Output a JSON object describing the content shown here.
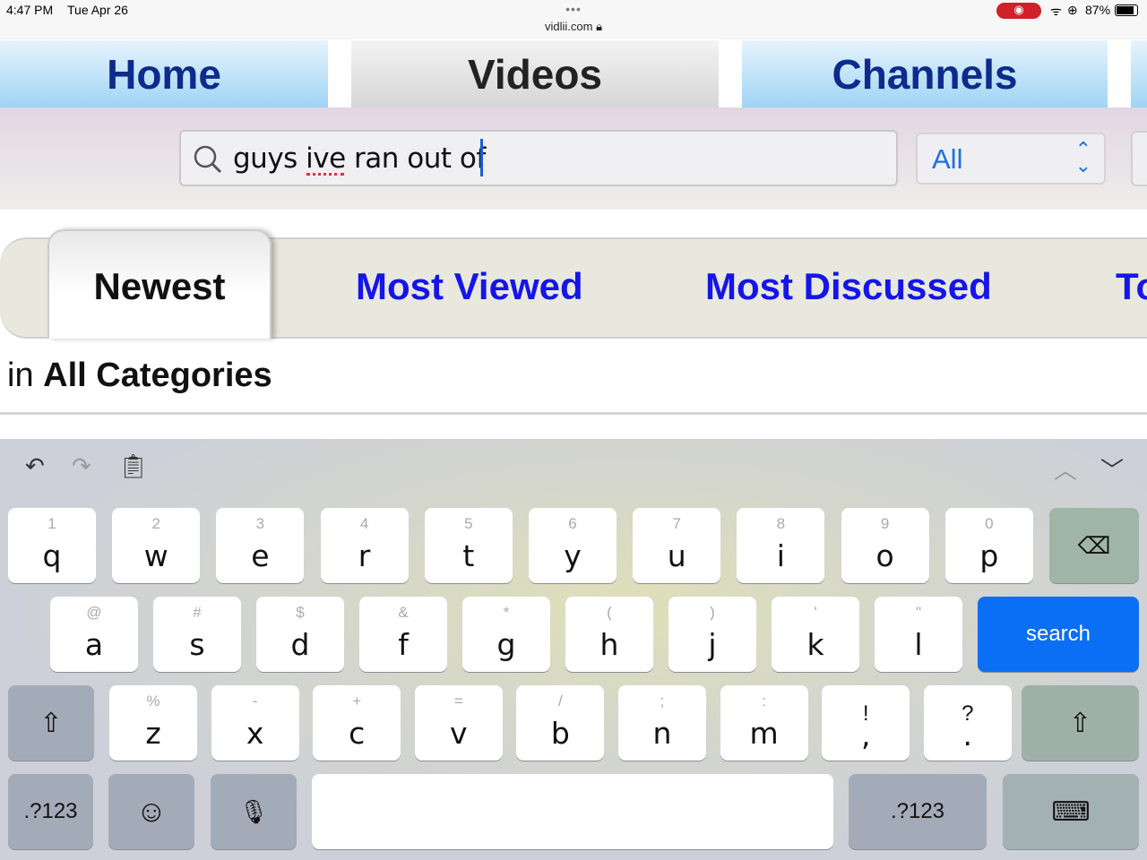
{
  "status": {
    "time": "4:47 PM",
    "date": "Tue Apr 26",
    "battery": "87%",
    "url": "vidlii.com"
  },
  "nav": {
    "tabs": [
      {
        "label": "Home",
        "active": false
      },
      {
        "label": "Videos",
        "active": true
      },
      {
        "label": "Channels",
        "active": false
      }
    ]
  },
  "search": {
    "value": "guys ive ran out of",
    "category": "All"
  },
  "sort": {
    "tabs": [
      "Newest",
      "Most Viewed",
      "Most Discussed",
      "To"
    ],
    "active": "Newest"
  },
  "category": {
    "prefix": "in",
    "name": "All Categories"
  },
  "keyboard": {
    "rows": [
      [
        [
          "1",
          "q"
        ],
        [
          "2",
          "w"
        ],
        [
          "3",
          "e"
        ],
        [
          "4",
          "r"
        ],
        [
          "5",
          "t"
        ],
        [
          "6",
          "y"
        ],
        [
          "7",
          "u"
        ],
        [
          "8",
          "i"
        ],
        [
          "9",
          "o"
        ],
        [
          "0",
          "p"
        ]
      ],
      [
        [
          "@",
          "a"
        ],
        [
          "#",
          "s"
        ],
        [
          "$",
          "d"
        ],
        [
          "&",
          "f"
        ],
        [
          "*",
          "g"
        ],
        [
          "(",
          "h"
        ],
        [
          ")",
          "j"
        ],
        [
          "'",
          "k"
        ],
        [
          "\"",
          "l"
        ]
      ],
      [
        [
          "%",
          "z"
        ],
        [
          "-",
          "x"
        ],
        [
          "+",
          "c"
        ],
        [
          "=",
          "v"
        ],
        [
          "/",
          "b"
        ],
        [
          ";",
          "n"
        ],
        [
          ":",
          "m"
        ],
        [
          "!",
          ","
        ],
        [
          "?",
          "."
        ]
      ]
    ],
    "search_label": "search",
    "numbers_label": ".?123",
    "accent": "#0a6ff5"
  }
}
